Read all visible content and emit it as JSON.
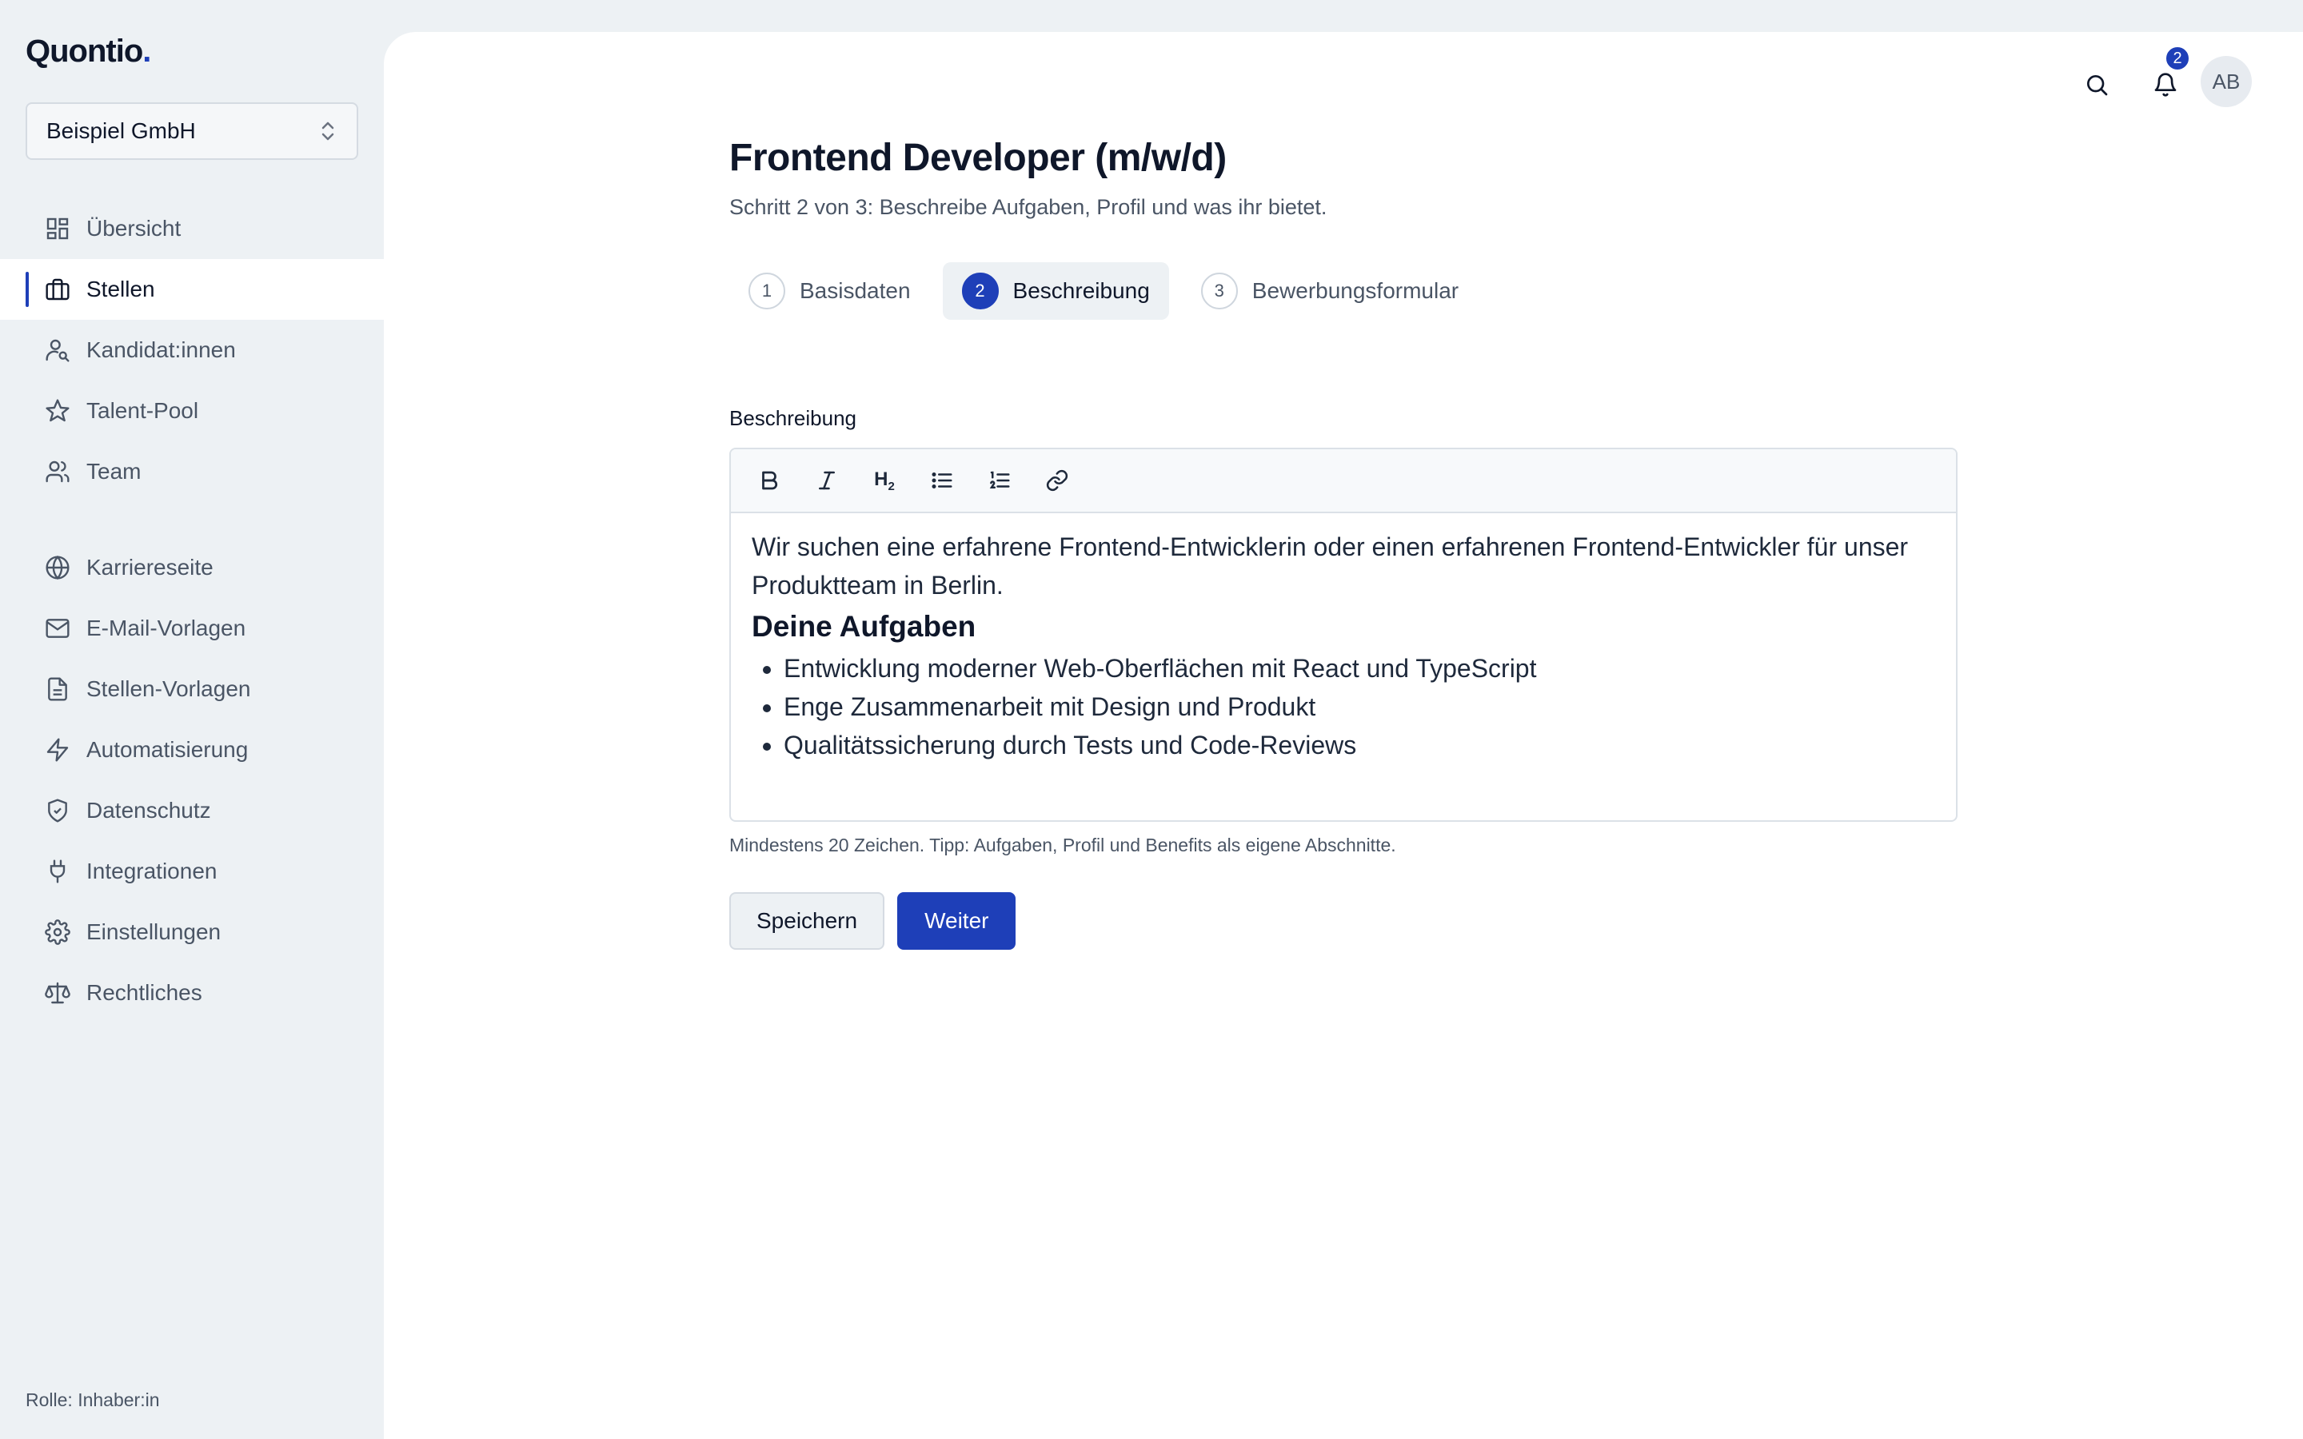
{
  "sidebar": {
    "logo": "Quontio",
    "logo_dot": ".",
    "org": "Beispiel GmbH",
    "items_top": [
      {
        "label": "Übersicht",
        "icon": "dashboard-icon",
        "active": false
      },
      {
        "label": "Stellen",
        "icon": "briefcase-icon",
        "active": true
      },
      {
        "label": "Kandidat:innen",
        "icon": "user-search-icon",
        "active": false
      },
      {
        "label": "Talent-Pool",
        "icon": "star-icon",
        "active": false
      },
      {
        "label": "Team",
        "icon": "users-icon",
        "active": false
      }
    ],
    "items_bottom": [
      {
        "label": "Karriereseite",
        "icon": "globe-icon"
      },
      {
        "label": "E-Mail-Vorlagen",
        "icon": "mail-icon"
      },
      {
        "label": "Stellen-Vorlagen",
        "icon": "document-icon"
      },
      {
        "label": "Automatisierung",
        "icon": "lightning-icon"
      },
      {
        "label": "Datenschutz",
        "icon": "shield-check-icon"
      },
      {
        "label": "Integrationen",
        "icon": "plug-icon"
      },
      {
        "label": "Einstellungen",
        "icon": "gear-icon"
      },
      {
        "label": "Rechtliches",
        "icon": "scale-icon"
      }
    ],
    "role": "Rolle: Inhaber:in"
  },
  "topbar": {
    "notification_count": "2",
    "avatar_initials": "AB"
  },
  "page": {
    "title": "Frontend Developer (m/w/d)",
    "subtitle": "Schritt 2 von 3: Beschreibe Aufgaben, Profil und was ihr bietet."
  },
  "steps": [
    {
      "num": "1",
      "label": "Basisdaten",
      "active": false
    },
    {
      "num": "2",
      "label": "Beschreibung",
      "active": true
    },
    {
      "num": "3",
      "label": "Bewerbungsformular",
      "active": false
    }
  ],
  "editor": {
    "label": "Beschreibung",
    "paragraph": "Wir suchen eine erfahrene Frontend-Entwicklerin oder einen erfahrenen Frontend-Entwickler für unser Produktteam in Berlin.",
    "heading": "Deine Aufgaben",
    "bullets": [
      "Entwicklung moderner Web-Oberflächen mit React und TypeScript",
      "Enge Zusammenarbeit mit Design und Produkt",
      "Qualitätssicherung durch Tests und Code-Reviews"
    ],
    "toolbar_h2": "H",
    "toolbar_h2_sub": "2",
    "hint": "Mindestens 20 Zeichen. Tipp: Aufgaben, Profil und Benefits als eigene Abschnitte."
  },
  "actions": {
    "save_label": "Speichern",
    "next_label": "Weiter"
  },
  "colors": {
    "accent": "#1e3fb8",
    "sidebar_bg": "#edf1f4"
  }
}
